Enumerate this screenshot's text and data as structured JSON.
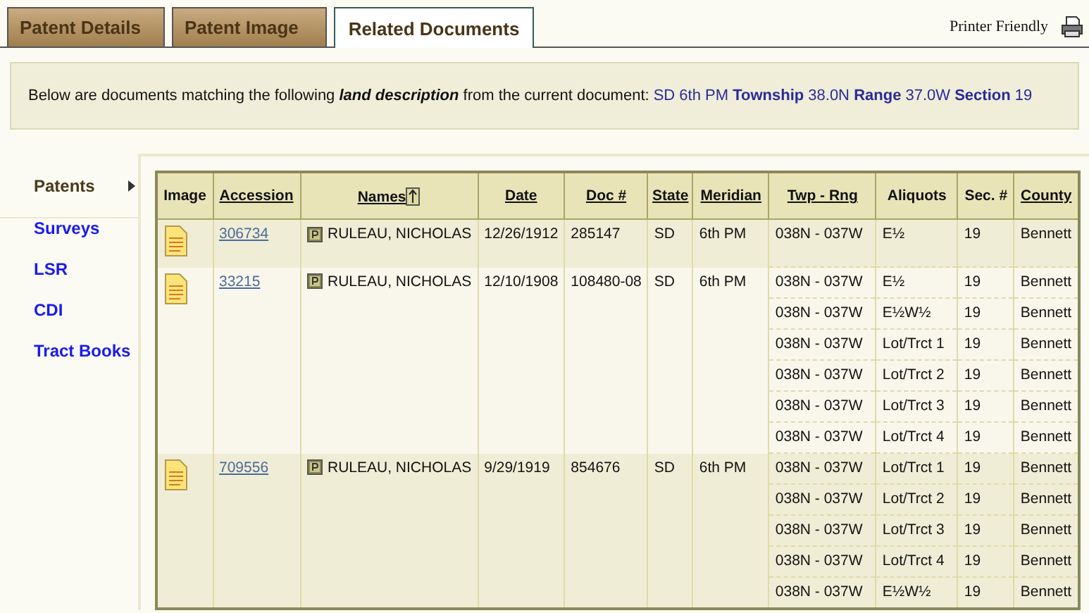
{
  "tabs": [
    {
      "label": "Patent Details",
      "selected": false
    },
    {
      "label": "Patent Image",
      "selected": false
    },
    {
      "label": "Related Documents",
      "selected": true
    }
  ],
  "printer_link": "Printer Friendly",
  "notice": {
    "text": "Below are documents matching the following **land description** from the current document:",
    "link": "SD 6th PM **Township** 38.0N **Range** 37.0W **Section** 19"
  },
  "sidebar": {
    "items": [
      {
        "label": "Patents",
        "selected": true
      },
      {
        "label": "Surveys",
        "selected": false
      },
      {
        "label": "LSR",
        "selected": false
      },
      {
        "label": "CDI",
        "selected": false
      },
      {
        "label": "Tract Books",
        "selected": false
      }
    ]
  },
  "table": {
    "columns": [
      {
        "label": "Image",
        "sortable": false,
        "sorted": false
      },
      {
        "label": "Accession",
        "sortable": true,
        "sorted": false
      },
      {
        "label": "Names",
        "sortable": true,
        "sorted": true
      },
      {
        "label": "Date",
        "sortable": true,
        "sorted": false
      },
      {
        "label": "Doc #",
        "sortable": true,
        "sorted": false
      },
      {
        "label": "State",
        "sortable": true,
        "sorted": false
      },
      {
        "label": "Meridian",
        "sortable": true,
        "sorted": false
      },
      {
        "label": "Twp - Rng",
        "sortable": true,
        "sorted": false
      },
      {
        "label": "Aliquots",
        "sortable": false,
        "sorted": false
      },
      {
        "label": "Sec. #",
        "sortable": false,
        "sorted": false
      },
      {
        "label": "County",
        "sortable": true,
        "sorted": false
      }
    ],
    "records": [
      {
        "accession": "306734",
        "name": "RULEAU, NICHOLAS",
        "date": "12/26/1912",
        "doc": "285147",
        "state": "SD",
        "meridian": "6th PM",
        "lands": [
          {
            "twp_rng": "038N - 037W",
            "aliquots": "E½",
            "section": "19",
            "county": "Bennett"
          }
        ]
      },
      {
        "accession": "33215",
        "name": "RULEAU, NICHOLAS",
        "date": "12/10/1908",
        "doc": "108480-08",
        "state": "SD",
        "meridian": "6th PM",
        "lands": [
          {
            "twp_rng": "038N - 037W",
            "aliquots": "E½",
            "section": "19",
            "county": "Bennett"
          },
          {
            "twp_rng": "038N - 037W",
            "aliquots": "E½W½",
            "section": "19",
            "county": "Bennett"
          },
          {
            "twp_rng": "038N - 037W",
            "aliquots": "Lot/Trct 1",
            "section": "19",
            "county": "Bennett"
          },
          {
            "twp_rng": "038N - 037W",
            "aliquots": "Lot/Trct 2",
            "section": "19",
            "county": "Bennett"
          },
          {
            "twp_rng": "038N - 037W",
            "aliquots": "Lot/Trct 3",
            "section": "19",
            "county": "Bennett"
          },
          {
            "twp_rng": "038N - 037W",
            "aliquots": "Lot/Trct 4",
            "section": "19",
            "county": "Bennett"
          }
        ]
      },
      {
        "accession": "709556",
        "name": "RULEAU, NICHOLAS",
        "date": "9/29/1919",
        "doc": "854676",
        "state": "SD",
        "meridian": "6th PM",
        "lands": [
          {
            "twp_rng": "038N - 037W",
            "aliquots": "Lot/Trct 1",
            "section": "19",
            "county": "Bennett"
          },
          {
            "twp_rng": "038N - 037W",
            "aliquots": "Lot/Trct 2",
            "section": "19",
            "county": "Bennett"
          },
          {
            "twp_rng": "038N - 037W",
            "aliquots": "Lot/Trct 3",
            "section": "19",
            "county": "Bennett"
          },
          {
            "twp_rng": "038N - 037W",
            "aliquots": "Lot/Trct 4",
            "section": "19",
            "county": "Bennett"
          },
          {
            "twp_rng": "038N - 037W",
            "aliquots": "E½W½",
            "section": "19",
            "county": "Bennett"
          }
        ]
      }
    ]
  }
}
